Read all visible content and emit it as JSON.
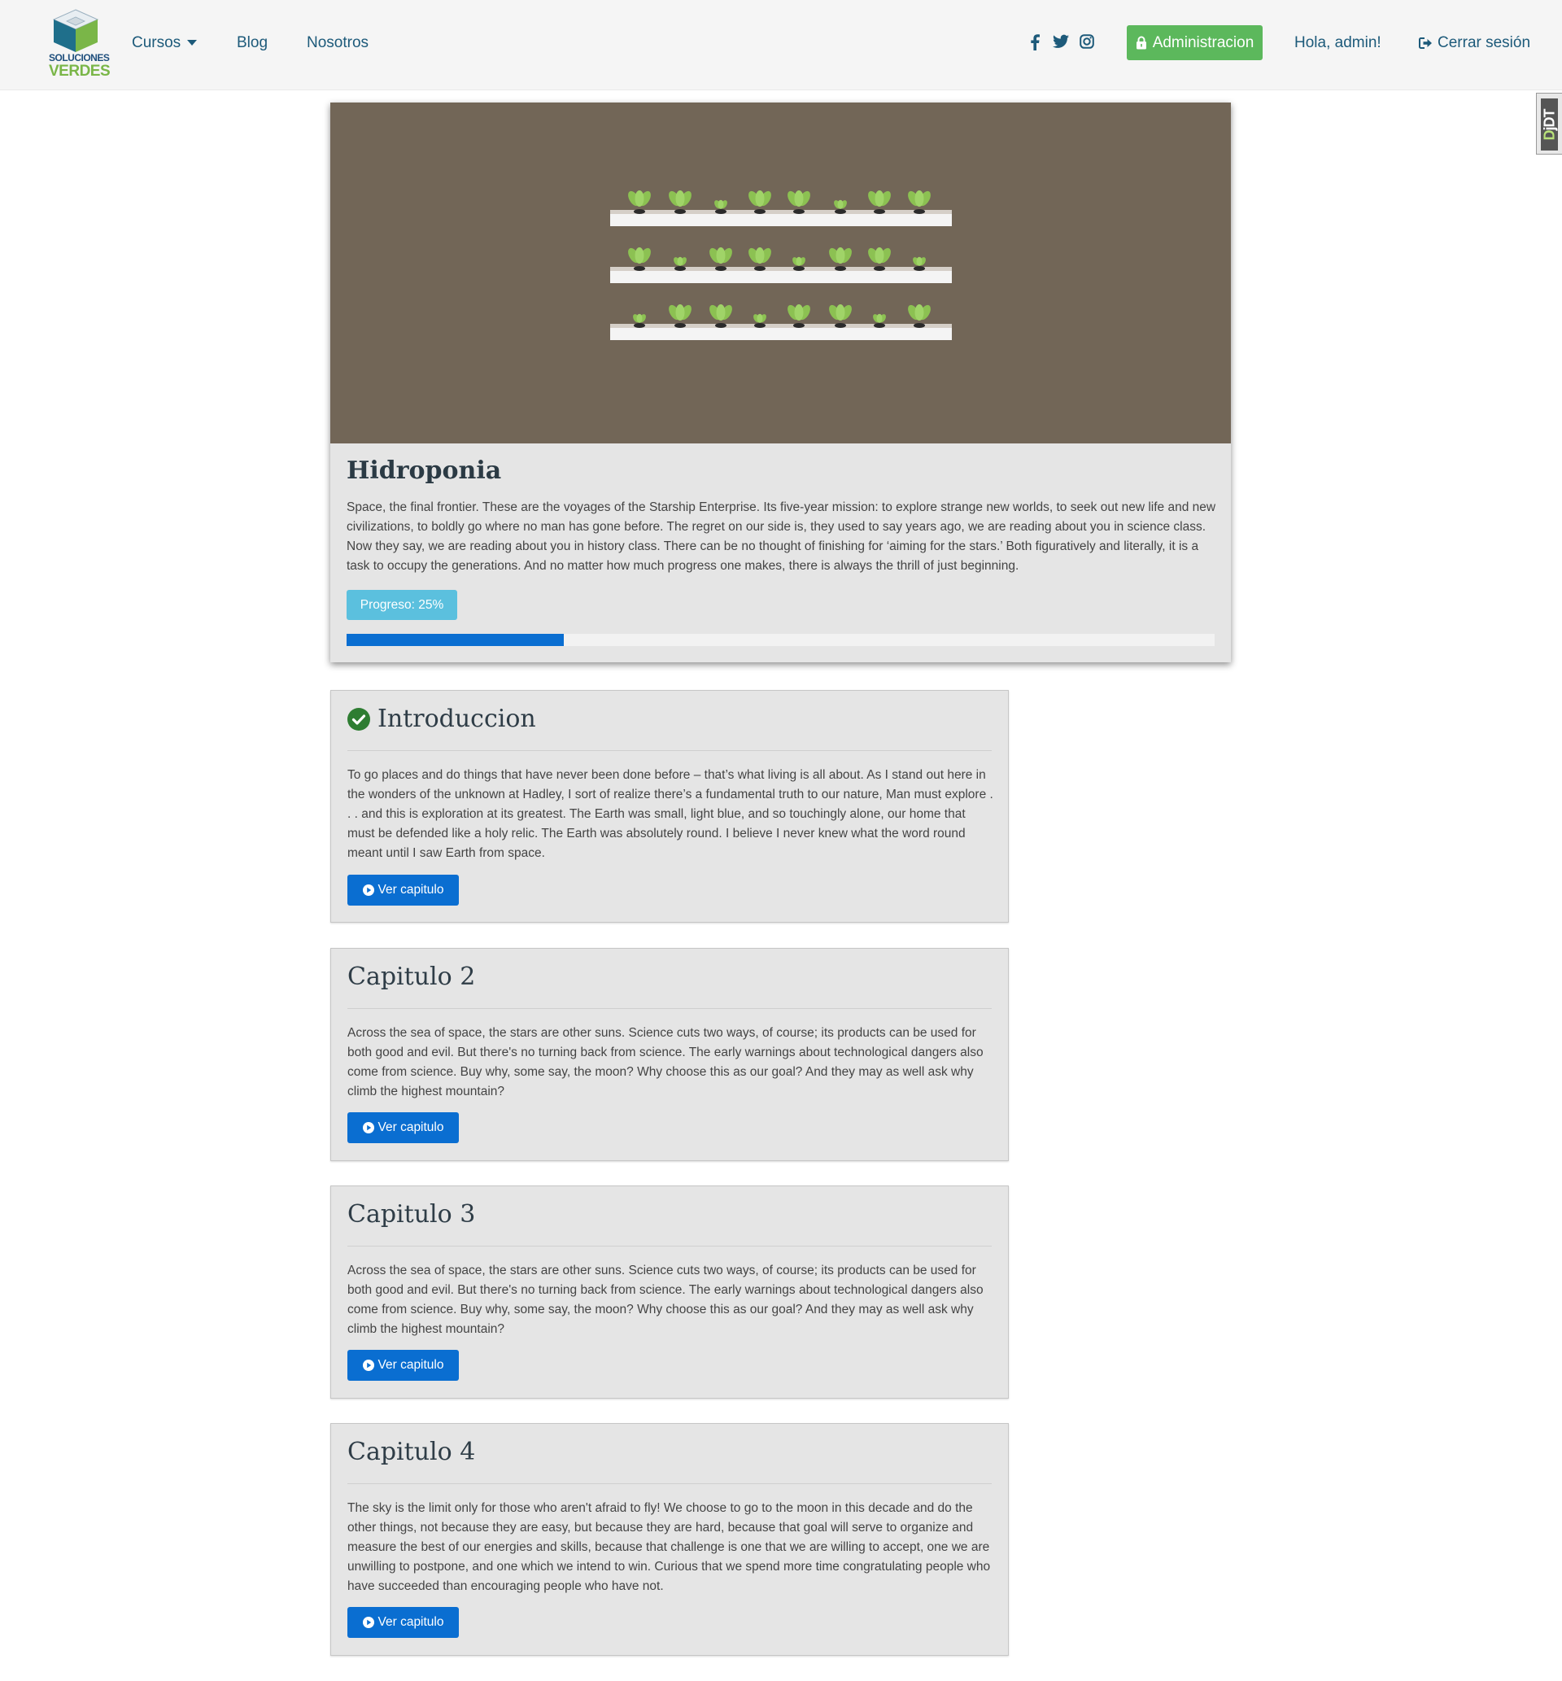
{
  "brand": {
    "line1": "SOLUCIONES",
    "line2": "VERDES",
    "colors": {
      "green": "#7ab648",
      "blue": "#1f4f7d"
    }
  },
  "nav": {
    "cursos": "Cursos",
    "blog": "Blog",
    "nosotros": "Nosotros",
    "social_icons": [
      "facebook-icon",
      "twitter-icon",
      "instagram-icon"
    ],
    "admin_button": "Administracion",
    "greeting": "Hola, admin!",
    "logout": "Cerrar sesión"
  },
  "debug_toolbar": {
    "label_d": "D",
    "label_rest": "jDT"
  },
  "course": {
    "title": "Hidroponia",
    "description": "Space, the final frontier. These are the voyages of the Starship Enterprise. Its five-year mission: to explore strange new worlds, to seek out new life and new civilizations, to boldly go where no man has gone before. The regret on our side is, they used to say years ago, we are reading about you in science class. Now they say, we are reading about you in history class. There can be no thought of finishing for ‘aiming for the stars.’ Both figuratively and literally, it is a task to occupy the generations. And no matter how much progress one makes, there is always the thrill of just beginning.",
    "progress_label": "Progreso: 25%",
    "progress_value": 25,
    "hero_color": "#726657"
  },
  "chapters": [
    {
      "title": "Introduccion",
      "completed": true,
      "text": "To go places and do things that have never been done before – that’s what living is all about. As I stand out here in the wonders of the unknown at Hadley, I sort of realize there’s a fundamental truth to our nature, Man must explore . . . and this is exploration at its greatest. The Earth was small, light blue, and so touchingly alone, our home that must be defended like a holy relic. The Earth was absolutely round. I believe I never knew what the word round meant until I saw Earth from space.",
      "button": "Ver capitulo"
    },
    {
      "title": "Capitulo 2",
      "completed": false,
      "text": "Across the sea of space, the stars are other suns. Science cuts two ways, of course; its products can be used for both good and evil. But there's no turning back from science. The early warnings about technological dangers also come from science. Buy why, some say, the moon? Why choose this as our goal? And they may as well ask why climb the highest mountain?",
      "button": "Ver capitulo"
    },
    {
      "title": "Capitulo 3",
      "completed": false,
      "text": "Across the sea of space, the stars are other suns. Science cuts two ways, of course; its products can be used for both good and evil. But there's no turning back from science. The early warnings about technological dangers also come from science. Buy why, some say, the moon? Why choose this as our goal? And they may as well ask why climb the highest mountain?",
      "button": "Ver capitulo"
    },
    {
      "title": "Capitulo 4",
      "completed": false,
      "text": "The sky is the limit only for those who aren't afraid to fly! We choose to go to the moon in this decade and do the other things, not because they are easy, but because they are hard, because that goal will serve to organize and measure the best of our energies and skills, because that challenge is one that we are willing to accept, one we are unwilling to postpone, and one which we intend to win. Curious that we spend more time congratulating people who have succeeded than encouraging people who have not.",
      "button": "Ver capitulo"
    }
  ]
}
